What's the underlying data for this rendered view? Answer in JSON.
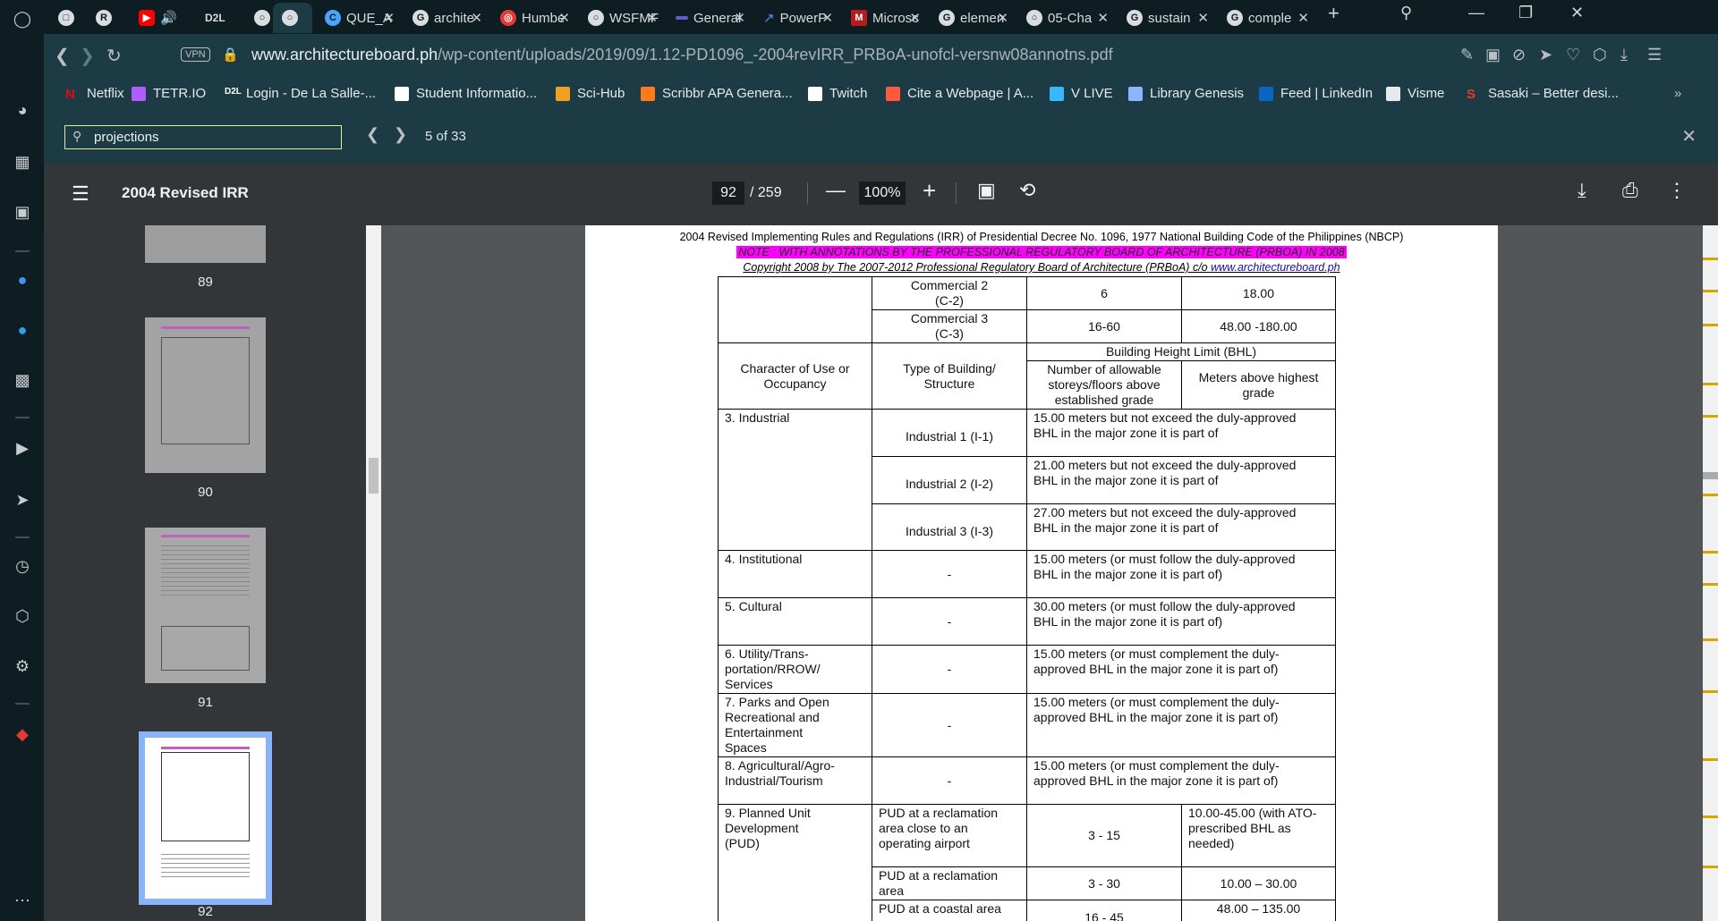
{
  "tabs": [
    {
      "label": "",
      "icon": "gamepad-icon"
    },
    {
      "label": "",
      "icon": "r-icon"
    },
    {
      "label": "",
      "icon": "youtube-icon"
    },
    {
      "label": "D2L",
      "icon": "d2l-icon"
    },
    {
      "label": "",
      "icon": "globe-icon"
    },
    {
      "label": "",
      "icon": "globe-icon",
      "active": true
    },
    {
      "label": "QUE_A",
      "icon": "c-icon"
    },
    {
      "label": "archite",
      "icon": "google-icon"
    },
    {
      "label": "Humbe",
      "icon": "target-icon"
    },
    {
      "label": "WSFMF",
      "icon": "globe-icon"
    },
    {
      "label": "General",
      "icon": "teams-icon"
    },
    {
      "label": "PowerP",
      "icon": "power-icon"
    },
    {
      "label": "Microsc",
      "icon": "microsoft-icon"
    },
    {
      "label": "elemen",
      "icon": "google-icon"
    },
    {
      "label": "05-Cha",
      "icon": "globe-icon"
    },
    {
      "label": "sustain",
      "icon": "google-icon"
    },
    {
      "label": "comple",
      "icon": "google-icon"
    }
  ],
  "address": {
    "vpn": "VPN",
    "url_host": "www.architectureboard.ph",
    "url_path": "/wp-content/uploads/2019/09/1.12-PD1096_-2004revIRR_PRBoA-unofcl-versnw08annotns.pdf"
  },
  "bookmarks": [
    {
      "label": "Netflix",
      "color": "#e50914"
    },
    {
      "label": "TETR.IO",
      "color": "#b05cff"
    },
    {
      "label": "Login - De La Salle-...",
      "color": "#ffffff"
    },
    {
      "label": "Student Informatio...",
      "color": "#ffffff"
    },
    {
      "label": "Sci-Hub",
      "color": "#f0a020"
    },
    {
      "label": "Scribbr APA Genera...",
      "color": "#ff7a1a"
    },
    {
      "label": "Twitch",
      "color": "#ffffff"
    },
    {
      "label": "Cite a Webpage | A...",
      "color": "#ff5a3c"
    },
    {
      "label": "V LIVE",
      "color": "#38b6ff"
    },
    {
      "label": "Library Genesis",
      "color": "#8fb4ff"
    },
    {
      "label": "Feed | LinkedIn",
      "color": "#0a66c2"
    },
    {
      "label": "Visme",
      "color": "#e6eaec"
    },
    {
      "label": "Sasaki – Better desi...",
      "color": "#e63b2e"
    }
  ],
  "find": {
    "query": "projections",
    "count": "5 of 33"
  },
  "pdf": {
    "title": "2004 Revised IRR",
    "page": "92",
    "total": "/ 259",
    "zoom": "100%"
  },
  "thumbs": [
    {
      "label": "89"
    },
    {
      "label": "90"
    },
    {
      "label": "91"
    },
    {
      "label": "92"
    }
  ],
  "doc": {
    "header1": "2004 Revised Implementing Rules and Regulations (IRR) of Presidential Decree No. 1096, 1977 National Building Code of the Philippines (NBCP)",
    "header2": "NOTE : WITH ANNOTATIONS BY THE PROFESSIONAL REGULATORY BOARD OF ARCHITECTURE (PRBOA) IN 2008",
    "header3": "Copyright 2008 by The 2007-2012 Professional Regulatory Board of Architecture (PRBoA) c/o ",
    "header3_link": "www.architectureboard.ph",
    "rows": {
      "c2_type": "Commercial 2\n(C-2)",
      "c2_storeys": "6",
      "c2_m": "18.00",
      "c3_type": "Commercial 3\n(C-3)",
      "c3_storeys": "16-60",
      "c3_m": "48.00 -180.00",
      "h_use": "Character of Use or Occupancy",
      "h_type": "Type of Building/ Structure",
      "h_bhl": "Building Height Limit (BHL)",
      "h_storeys": "Number of allowable storeys/floors above established grade",
      "h_meters": "Meters above highest grade",
      "ind": "3.  Industrial",
      "i1": "Industrial 1 (I-1)",
      "i1_bhl": "15.00 meters but not exceed the duly-approved BHL in the major zone it is part of",
      "i2": "Industrial 2 (I-2)",
      "i2_bhl": "21.00 meters but not exceed the duly-approved BHL in the major zone it is part of",
      "i3": "Industrial 3 (I-3)",
      "i3_bhl": "27.00 meters but not exceed the duly-approved BHL in the major zone it is part of",
      "inst": "4.  Institutional",
      "inst_type": "-",
      "inst_bhl": "15.00 meters (or must follow the duly-approved BHL in the major zone it is part of)",
      "cult": "5.  Cultural",
      "cult_type": "-",
      "cult_bhl": "30.00 meters (or must follow the duly-approved BHL in the major zone it is part of)",
      "util": "6.  Utility/Trans-\n     portation/RROW/\n     Services",
      "util_type": "-",
      "util_bhl": "15.00 meters (or must complement the duly-approved BHL in the major zone it is part of)",
      "parks": "7.  Parks and Open\n     Recreational and\n     Entertainment\n     Spaces",
      "parks_type": "-",
      "parks_bhl": "15.00 meters (or must complement the duly-approved BHL in the major zone it is part of)",
      "agri": "8.  Agricultural/Agro-\n     Industrial/Tourism",
      "agri_type": "-",
      "agri_bhl": "15.00 meters (or must complement the duly-approved BHL in the major zone it is part of)",
      "pud": "9.  Planned Unit\n     Development\n     (PUD)",
      "pud1_type": "PUD at a reclamation area close to an operating airport",
      "pud1_storeys": "3 - 15",
      "pud1_m": "10.00-45.00 (with ATO-prescribed BHL as needed)",
      "pud2_type": "PUD at a reclamation area",
      "pud2_storeys": "3 - 30",
      "pud2_m": "10.00 – 30.00",
      "pud3_type": "PUD at a coastal area",
      "pud3_storeys": "16 - 45",
      "pud3_m": "48.00 – 135.00"
    }
  }
}
